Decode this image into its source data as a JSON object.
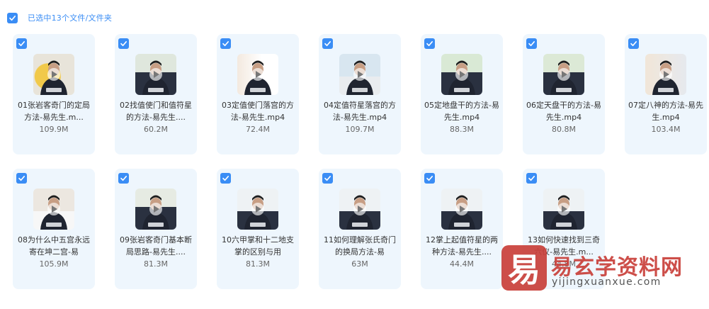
{
  "header": {
    "selection_text": "已选中13个文件/文件夹"
  },
  "files": [
    {
      "name": "01张岩客奇门的定局方法-易先生.m...",
      "size": "109.9M"
    },
    {
      "name": "02找值使门和值符星的方法-易先生....",
      "size": "60.2M"
    },
    {
      "name": "03定值使门落宫的方法-易先生.mp4",
      "size": "72.4M"
    },
    {
      "name": "04定值符星落宫的方法-易先生.mp4",
      "size": "109.7M"
    },
    {
      "name": "05定地盘干的方法-易先生.mp4",
      "size": "88.3M"
    },
    {
      "name": "06定天盘干的方法-易先生.mp4",
      "size": "80.8M"
    },
    {
      "name": "07定八神的方法-易先生.mp4",
      "size": "103.4M"
    },
    {
      "name": "08为什么中五宫永远寄在坤二宫-易",
      "size": "105.9M"
    },
    {
      "name": "09张岩客奇门基本断局思路-易先生....",
      "size": "81.3M"
    },
    {
      "name": "10六甲掌和十二地支掌的区别与用",
      "size": "81.3M"
    },
    {
      "name": "11如何理解张氏奇门的换局方法-易",
      "size": "63M"
    },
    {
      "name": "12掌上起值符星的两种方法-易先生....",
      "size": "44.4M"
    },
    {
      "name": "13如何快速找到三奇六仪-易先生.m...",
      "size": "44.8M"
    }
  ],
  "watermark": {
    "logo_char": "易",
    "title": "易玄学资料网",
    "url": "yijingxuanxue.com"
  }
}
